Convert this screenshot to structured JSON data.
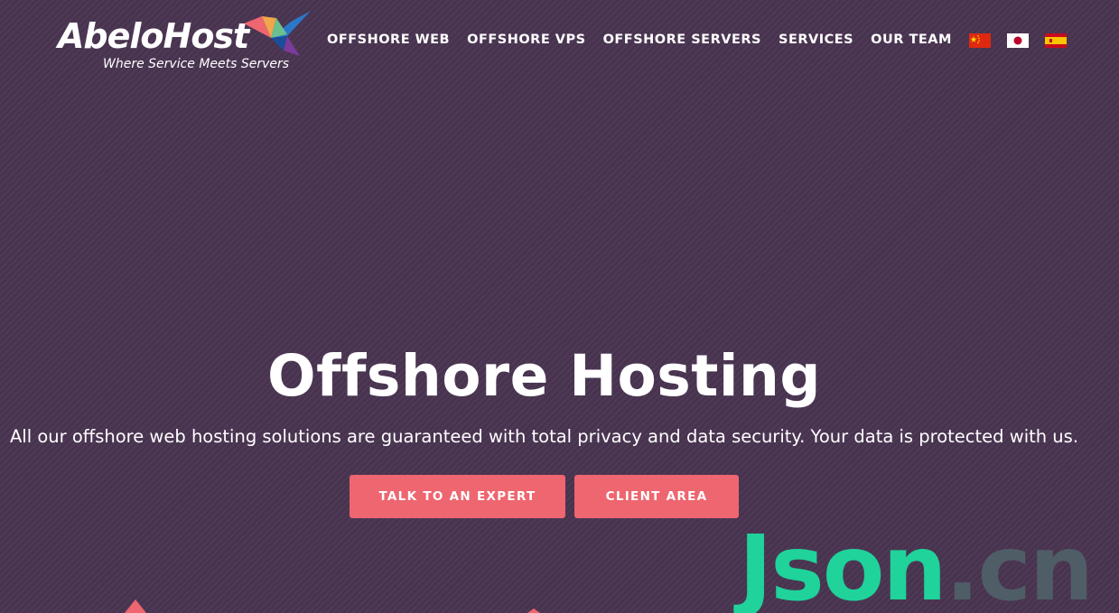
{
  "brand": {
    "name": "AbeloHost",
    "tagline": "Where Service Meets Servers"
  },
  "nav": {
    "items": [
      {
        "label": "OFFSHORE WEB"
      },
      {
        "label": "OFFSHORE VPS"
      },
      {
        "label": "OFFSHORE SERVERS"
      },
      {
        "label": "SERVICES"
      },
      {
        "label": "OUR TEAM"
      }
    ],
    "flags": [
      "china-flag-icon",
      "japan-flag-icon",
      "spain-flag-icon"
    ]
  },
  "hero": {
    "title": "Offshore Hosting",
    "subtitle": "All our offshore web hosting solutions are guaranteed with total privacy and data security. Your data is protected with us.",
    "buttons": {
      "talk": "TALK TO AN EXPERT",
      "client": "CLIENT AREA"
    }
  },
  "watermark": {
    "main": "Json",
    "tld": ".cn"
  },
  "colors": {
    "background": "#4a3552",
    "accent": "#ee6670",
    "watermark_green": "#1fd39a",
    "watermark_grey": "#4f5d66"
  }
}
